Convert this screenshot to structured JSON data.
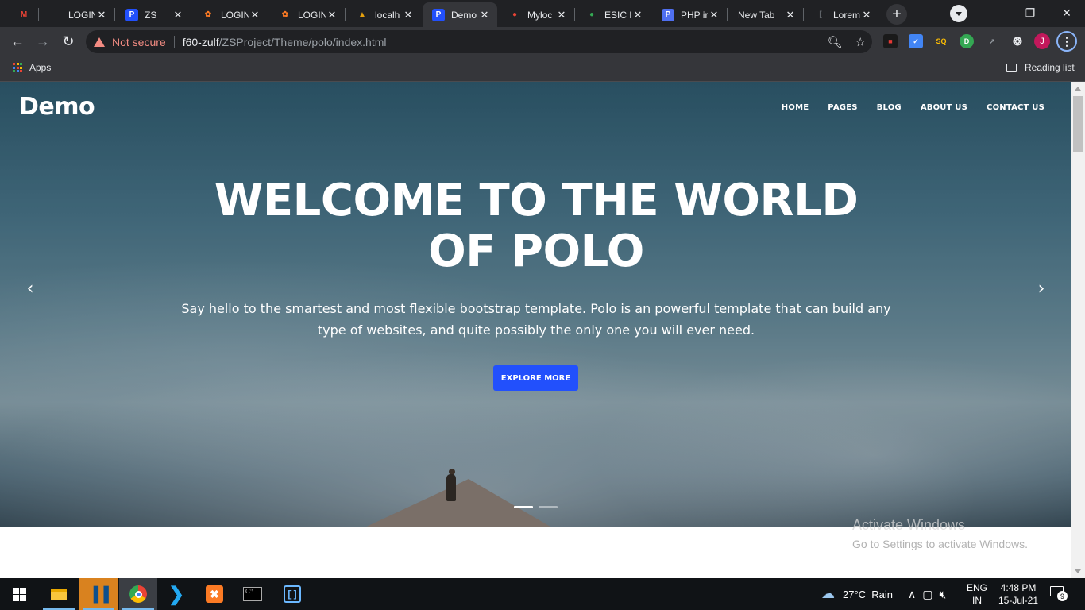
{
  "browser": {
    "tabs": [
      {
        "title": "",
        "favicon": "gmail-icon",
        "fav_text": "M",
        "fav_color": "#ea4335"
      },
      {
        "title": "LOGIN",
        "favicon": "site-icon",
        "fav_text": "",
        "fav_color": "#3c4043"
      },
      {
        "title": "ZS",
        "favicon": "polo-icon",
        "fav_text": "P",
        "fav_color": "#2250fc"
      },
      {
        "title": "LOGIN",
        "favicon": "xampp-icon",
        "fav_text": "✿",
        "fav_color": "#fb7a24"
      },
      {
        "title": "LOGIN",
        "favicon": "xampp-icon",
        "fav_text": "✿",
        "fav_color": "#fb7a24"
      },
      {
        "title": "localh",
        "favicon": "phpmyadmin-icon",
        "fav_text": "▲",
        "fav_color": "#e5a00d"
      },
      {
        "title": "Demo",
        "favicon": "polo-icon",
        "fav_text": "P",
        "fav_color": "#2250fc"
      },
      {
        "title": "Myloc",
        "favicon": "maps-pin-icon",
        "fav_text": "●",
        "fav_color": "#ea4335"
      },
      {
        "title": "ESIC E",
        "favicon": "google-maps-icon",
        "fav_text": "●",
        "fav_color": "#34a853"
      },
      {
        "title": "PHP ir",
        "favicon": "php-icon",
        "fav_text": "P",
        "fav_color": "#4f6ff0"
      },
      {
        "title": "New Tab",
        "favicon": "",
        "fav_text": "",
        "fav_color": ""
      },
      {
        "title": "Lorem",
        "favicon": "doc-icon",
        "fav_text": "[",
        "fav_color": "#5f6368"
      }
    ],
    "security_label": "Not secure",
    "url_host": "f60-zulf",
    "url_path": "/ZSProject/Theme/polo/index.html",
    "profile_initial": "J",
    "bookmarks": {
      "apps": "Apps",
      "reading_list": "Reading list"
    }
  },
  "page": {
    "brand": "Demo",
    "nav": [
      "HOME",
      "PAGES",
      "BLOG",
      "ABOUT US",
      "CONTACT US"
    ],
    "headline_line1": "WELCOME TO THE WORLD",
    "headline_line2": "OF POLO",
    "subtext_line1": "Say hello to the smartest and most flexible bootstrap template. Polo is an powerful template that can build any",
    "subtext_line2": "type of websites, and quite possibly the only one you will ever need.",
    "cta": "EXPLORE MORE",
    "accent_color": "#2250fc",
    "slider": {
      "total": 2,
      "active": 1
    }
  },
  "watermark": {
    "title": "Activate Windows",
    "subtitle": "Go to Settings to activate Windows."
  },
  "taskbar": {
    "weather": "27°C  Rain",
    "lang_top": "ENG",
    "lang_bottom": "IN",
    "time": "4:48 PM",
    "date": "15-Jul-21",
    "notifications": "9"
  }
}
